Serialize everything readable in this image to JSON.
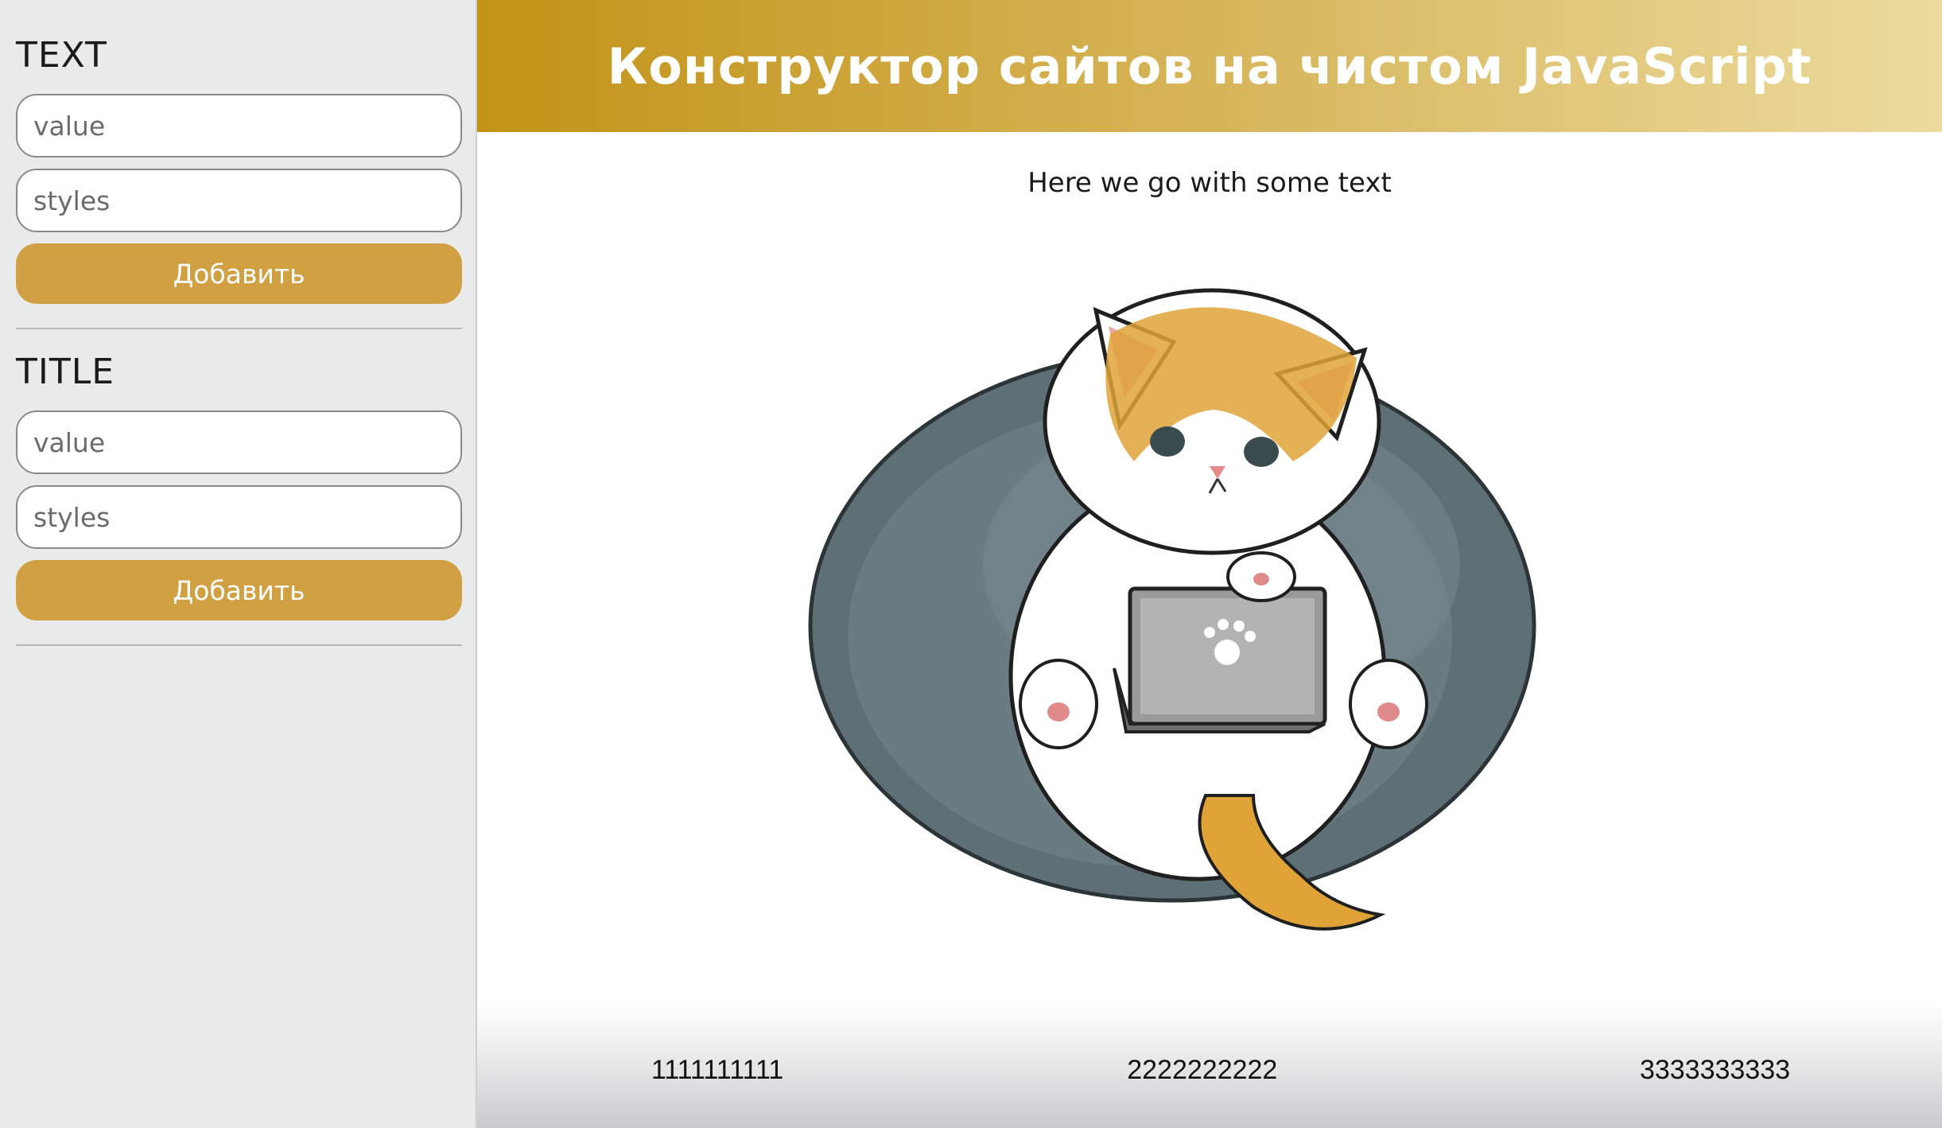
{
  "sidebar": {
    "sections": [
      {
        "title": "TEXT",
        "value_placeholder": "value",
        "styles_placeholder": "styles",
        "button_label": "Добавить"
      },
      {
        "title": "TITLE",
        "value_placeholder": "value",
        "styles_placeholder": "styles",
        "button_label": "Добавить"
      }
    ]
  },
  "header": {
    "title": "Конструктор сайтов на чистом JavaScript"
  },
  "content": {
    "text": "Here we go with some text",
    "image": "cat-with-laptop-illustration"
  },
  "footer": {
    "columns": [
      "1111111111",
      "2222222222",
      "3333333333"
    ]
  },
  "colors": {
    "accent": "#d1a042",
    "header_start": "#c29317",
    "header_end": "#ecdb9e",
    "sidebar_bg": "#e9eaea"
  }
}
